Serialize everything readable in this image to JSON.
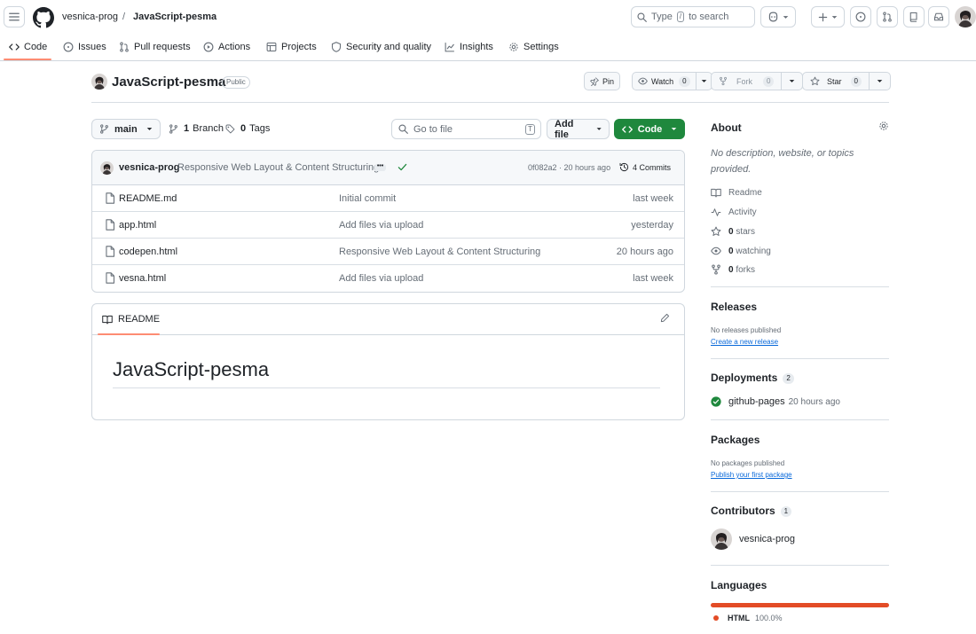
{
  "header": {
    "owner": "vesnica-prog",
    "separator": "/",
    "repo": "JavaScript-pesma",
    "search_prefix": "Type",
    "search_key": "/",
    "search_suffix": "to search"
  },
  "repo_nav": {
    "tabs": [
      {
        "label": "Code",
        "icon": "code-icon"
      },
      {
        "label": "Issues",
        "icon": "issue-icon"
      },
      {
        "label": "Pull requests",
        "icon": "pull-request-icon"
      },
      {
        "label": "Actions",
        "icon": "play-icon"
      },
      {
        "label": "Projects",
        "icon": "table-icon"
      },
      {
        "label": "Security and quality",
        "icon": "shield-icon"
      },
      {
        "label": "Insights",
        "icon": "graph-icon"
      },
      {
        "label": "Settings",
        "icon": "gear-icon"
      }
    ]
  },
  "repo_header": {
    "title": "JavaScript-pesma",
    "visibility": "Public",
    "pin_label": "Pin",
    "watch_label": "Watch",
    "watch_count": "0",
    "fork_label": "Fork",
    "fork_count": "0",
    "star_label": "Star",
    "star_count": "0"
  },
  "controls": {
    "branch": "main",
    "branch_count": "1",
    "branch_label": "Branch",
    "tag_count": "0",
    "tag_label": "Tags",
    "goto_placeholder": "Go to file",
    "goto_key": "T",
    "add_file_label": "Add file",
    "code_label": "Code"
  },
  "latest_commit": {
    "author": "vesnica-prog",
    "message": "Responsive Web Layout & Content Structuring",
    "dots": "•••",
    "sha_time": "0f082a2 · 20 hours ago",
    "commits_label": "4 Commits"
  },
  "files": [
    {
      "name": "README.md",
      "message": "Initial commit",
      "date": "last week"
    },
    {
      "name": "app.html",
      "message": "Add files via upload",
      "date": "yesterday"
    },
    {
      "name": "codepen.html",
      "message": "Responsive Web Layout & Content Structuring",
      "date": "20 hours ago"
    },
    {
      "name": "vesna.html",
      "message": "Add files via upload",
      "date": "last week"
    }
  ],
  "readme": {
    "tab_label": "README",
    "heading": "JavaScript-pesma"
  },
  "sidebar": {
    "about_title": "About",
    "description": "No description, website, or topics provided.",
    "readme_label": "Readme",
    "activity_label": "Activity",
    "stars_count": "0",
    "stars_label": "stars",
    "watching_count": "0",
    "watching_label": "watching",
    "forks_count": "0",
    "forks_label": "forks",
    "releases_title": "Releases",
    "releases_empty": "No releases published",
    "releases_link": "Create a new release",
    "deployments_title": "Deployments",
    "deployments_count": "2",
    "deployment_name": "github-pages",
    "deployment_time": "20 hours ago",
    "packages_title": "Packages",
    "packages_empty": "No packages published",
    "packages_link": "Publish your first package",
    "contributors_title": "Contributors",
    "contributors_count": "1",
    "contributor_name": "vesnica-prog",
    "languages_title": "Languages",
    "language_name": "HTML",
    "language_percent": "100.0%",
    "language_fraction": 1.0,
    "language_color": "#e34c26"
  },
  "colors": {
    "accent_underline": "#fd8c73",
    "code_button": "#1f883d",
    "link": "#0969da",
    "success": "#1f883d"
  }
}
